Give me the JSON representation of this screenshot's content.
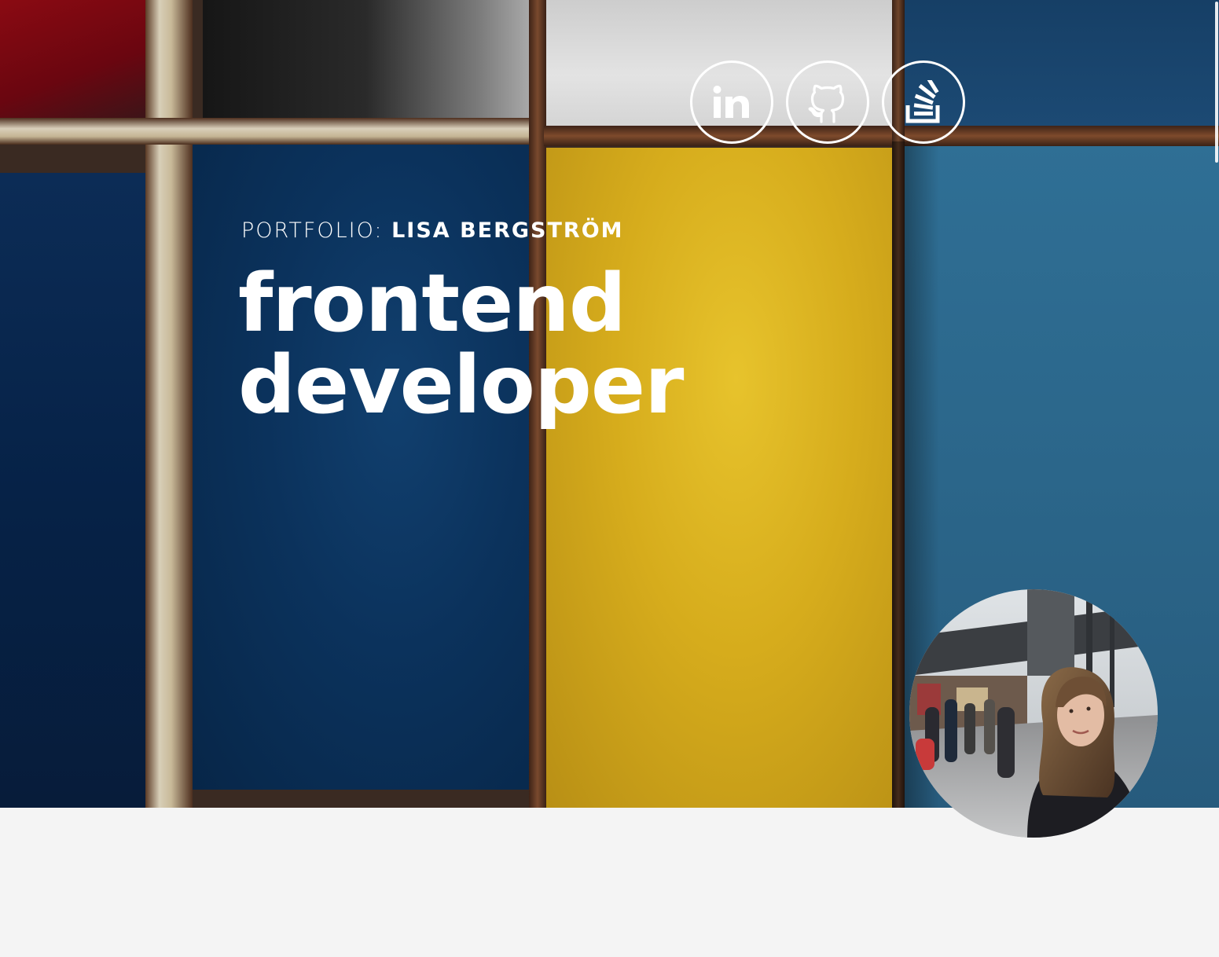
{
  "hero": {
    "eyebrow_prefix": "PORTFOLIO:",
    "eyebrow_name": "LISA BERGSTRÖM",
    "headline_line1": "frontend",
    "headline_line2": "developer"
  },
  "social": [
    {
      "name": "linkedin",
      "icon": "linkedin-icon"
    },
    {
      "name": "github",
      "icon": "github-icon"
    },
    {
      "name": "stackoverflow",
      "icon": "stackoverflow-icon"
    }
  ],
  "colors": {
    "hero_text": "#ffffff",
    "page_background": "#f4f4f4",
    "panel_red": "#8a0a12",
    "panel_blue": "#0b325c",
    "panel_yellow": "#d6ac1c",
    "panel_steel": "#2b668a"
  }
}
